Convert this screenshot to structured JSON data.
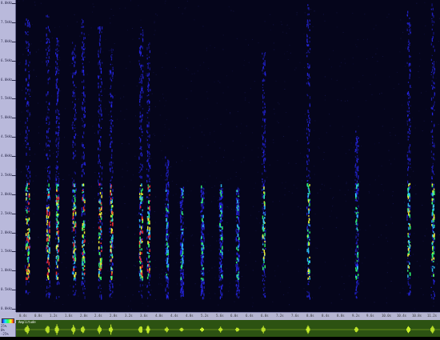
{
  "frequency_axis": {
    "labels": [
      "8.0kHz",
      "7.5kHz",
      "7.0kHz",
      "6.5kHz",
      "6.0kHz",
      "5.5kHz",
      "5.0kHz",
      "4.5kHz",
      "4.0kHz",
      "3.5kHz",
      "3.0kHz",
      "2.5kHz",
      "2.0kHz",
      "1.5kHz",
      "1.0kHz",
      "0.5kHz",
      "0.0kHz"
    ]
  },
  "time_ruler": {
    "labels": [
      "0.4s",
      "0.8s",
      "1.2s",
      "1.6s",
      "2.0s",
      "2.4s",
      "2.8s",
      "3.2s",
      "3.6s",
      "4.0s",
      "4.4s",
      "4.8s",
      "5.2s",
      "5.6s",
      "6.0s",
      "6.4s",
      "6.8s",
      "7.2s",
      "7.6s",
      "8.0s",
      "8.4s",
      "8.8s",
      "9.2s",
      "9.6s",
      "10.0s",
      "10.4s",
      "10.8s",
      "11.2s"
    ]
  },
  "waveform": {
    "title": "Amplitude",
    "amp_labels": [
      "25%",
      "0%",
      "-25%"
    ]
  },
  "colors": {
    "spectrogram_bg": "#05051b",
    "waveform_bg": "#2c5212",
    "waveform_line": "#c8f02a",
    "panel_bg": "#b9b9db"
  },
  "spectrogram": {
    "freq_max_khz": 8,
    "duration_s": 11.4,
    "calls": [
      {
        "t": 0.3,
        "w": 0.12,
        "fmax": 7.6,
        "peak": 1.0
      },
      {
        "t": 0.85,
        "w": 0.1,
        "fmax": 7.8,
        "peak": 1.0
      },
      {
        "t": 1.1,
        "w": 0.08,
        "fmax": 7.2,
        "peak": 0.95
      },
      {
        "t": 1.55,
        "w": 0.1,
        "fmax": 7.0,
        "peak": 0.95
      },
      {
        "t": 1.8,
        "w": 0.08,
        "fmax": 7.6,
        "peak": 0.95
      },
      {
        "t": 2.25,
        "w": 0.1,
        "fmax": 7.4,
        "peak": 0.9
      },
      {
        "t": 2.55,
        "w": 0.08,
        "fmax": 6.8,
        "peak": 0.9
      },
      {
        "t": 3.35,
        "w": 0.1,
        "fmax": 7.4,
        "peak": 1.0
      },
      {
        "t": 3.55,
        "w": 0.06,
        "fmax": 7.0,
        "peak": 0.9
      },
      {
        "t": 4.05,
        "w": 0.02,
        "fmax": 4.0,
        "peak": 0.4
      },
      {
        "t": 4.45,
        "w": 0.02,
        "fmax": 3.2,
        "peak": 0.35
      },
      {
        "t": 5.0,
        "w": 0.02,
        "fmax": 3.2,
        "peak": 0.35
      },
      {
        "t": 5.5,
        "w": 0.02,
        "fmax": 3.2,
        "peak": 0.35
      },
      {
        "t": 5.95,
        "w": 0.02,
        "fmax": 3.2,
        "peak": 0.35
      },
      {
        "t": 6.65,
        "w": 0.06,
        "fmax": 6.8,
        "peak": 0.7
      },
      {
        "t": 7.85,
        "w": 0.06,
        "fmax": 8.0,
        "peak": 0.75
      },
      {
        "t": 9.15,
        "w": 0.02,
        "fmax": 4.8,
        "peak": 0.5
      },
      {
        "t": 10.55,
        "w": 0.05,
        "fmax": 7.8,
        "peak": 0.8
      },
      {
        "t": 11.2,
        "w": 0.06,
        "fmax": 8.0,
        "peak": 0.85
      }
    ]
  }
}
